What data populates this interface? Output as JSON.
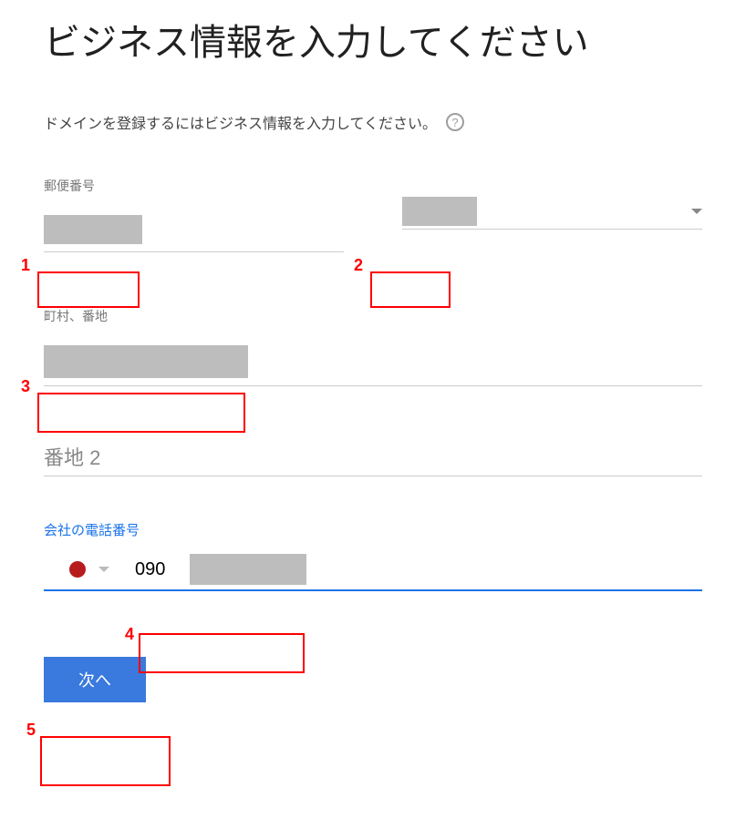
{
  "title": "ビジネス情報を入力してください",
  "subtitle": "ドメインを登録するにはビジネス情報を入力してください。",
  "help_symbol": "?",
  "fields": {
    "postal": {
      "label": "郵便番号"
    },
    "prefecture": {
      "label": ""
    },
    "town": {
      "label": "町村、番地"
    },
    "address2": {
      "placeholder": "番地 2"
    },
    "phone": {
      "label": "会社の電話番号",
      "value": "090"
    }
  },
  "button": {
    "next": "次へ"
  },
  "annotations": [
    "1",
    "2",
    "3",
    "4",
    "5"
  ]
}
